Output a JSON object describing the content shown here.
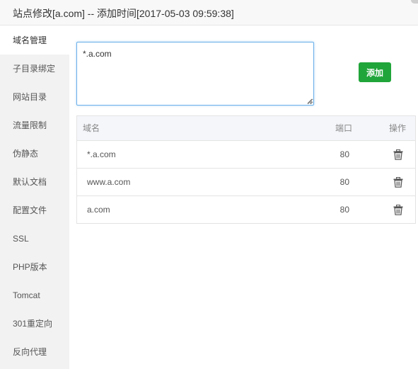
{
  "title": "站点修改[a.com] -- 添加时间[2017-05-03 09:59:38]",
  "sidebar": {
    "items": [
      {
        "label": "域名管理",
        "active": true
      },
      {
        "label": "子目录绑定"
      },
      {
        "label": "网站目录"
      },
      {
        "label": "流量限制"
      },
      {
        "label": "伪静态"
      },
      {
        "label": "默认文档"
      },
      {
        "label": "配置文件"
      },
      {
        "label": "SSL"
      },
      {
        "label": "PHP版本"
      },
      {
        "label": "Tomcat"
      },
      {
        "label": "301重定向"
      },
      {
        "label": "反向代理"
      }
    ]
  },
  "domain_input": {
    "value": "*.a.com"
  },
  "add_button": {
    "label": "添加",
    "color": "#20a53a"
  },
  "table": {
    "headers": {
      "domain": "域名",
      "port": "端口",
      "action": "操作"
    },
    "rows": [
      {
        "domain": "*.a.com",
        "port": "80",
        "action_icon": "trash-icon"
      },
      {
        "domain": "www.a.com",
        "port": "80",
        "action_icon": "trash-icon"
      },
      {
        "domain": "a.com",
        "port": "80",
        "action_icon": "trash-icon"
      }
    ]
  }
}
